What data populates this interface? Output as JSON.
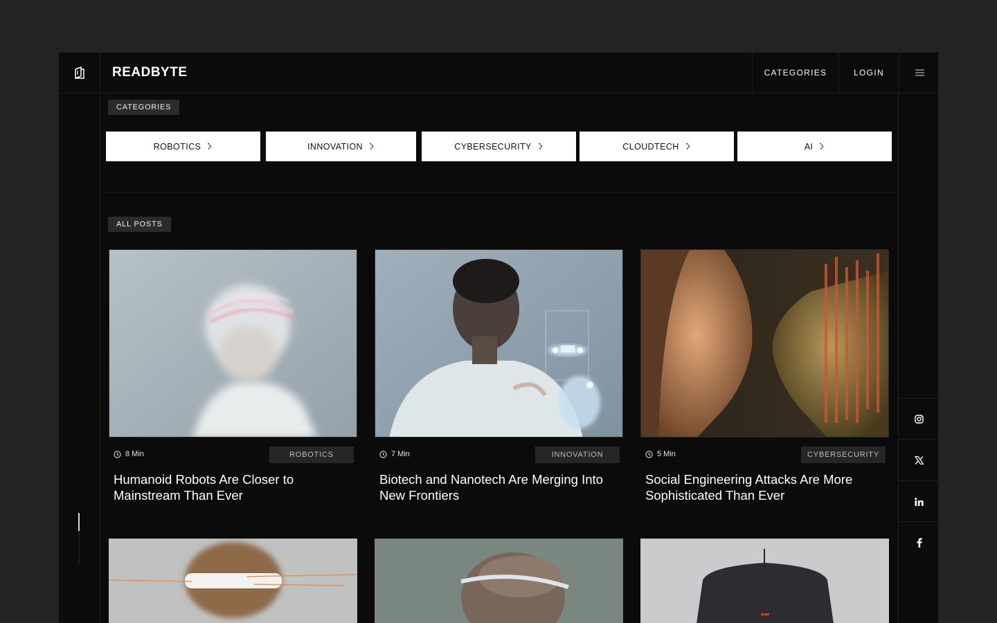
{
  "header": {
    "brand": "READBYTE",
    "nav_categories": "CATEGORIES",
    "nav_login": "LOGIN"
  },
  "categories_section": {
    "label": "CATEGORIES",
    "items": [
      {
        "label": "ROBOTICS"
      },
      {
        "label": "INNOVATION"
      },
      {
        "label": "CYBERSECURITY"
      },
      {
        "label": "CLOUDTECH"
      },
      {
        "label": "AI"
      }
    ]
  },
  "posts_section": {
    "label": "ALL POSTS",
    "posts": [
      {
        "read_time": "8 Min",
        "category": "ROBOTICS",
        "title": "Humanoid Robots Are Closer to Mainstream Than Ever"
      },
      {
        "read_time": "7 Min",
        "category": "INNOVATION",
        "title": "Biotech and Nanotech Are Merging Into New Frontiers"
      },
      {
        "read_time": "5 Min",
        "category": "CYBERSECURITY",
        "title": "Social Engineering Attacks Are More Sophisticated Than Ever"
      }
    ]
  },
  "social": [
    "instagram-icon",
    "x-icon",
    "linkedin-icon",
    "facebook-icon"
  ],
  "colors": {
    "background": "#232323",
    "panel": "#0b0b0b",
    "border": "#1e1e1e",
    "tag_bg": "#2b2b2b",
    "button_bg": "#ffffff"
  }
}
